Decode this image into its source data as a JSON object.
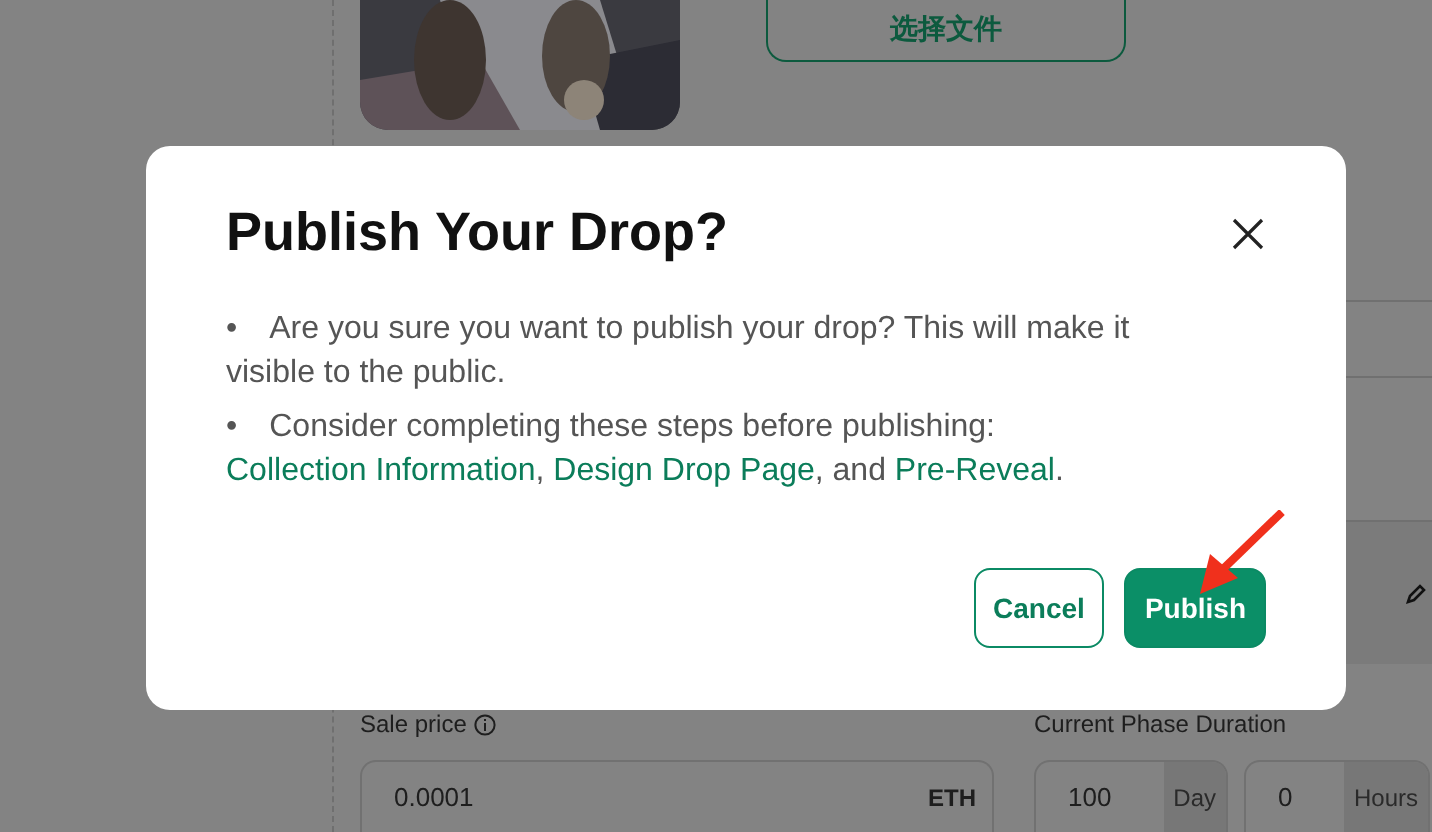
{
  "background": {
    "choose_file_button": "选择文件",
    "sale_price": {
      "label": "Sale price",
      "value": "0.0001",
      "unit": "ETH"
    },
    "duration": {
      "label": "Current Phase Duration",
      "fields": [
        {
          "value": "100",
          "unit": "Day"
        },
        {
          "value": "0",
          "unit": "Hours"
        }
      ]
    }
  },
  "dialog": {
    "title": "Publish Your Drop?",
    "marker": "•",
    "bullets": [
      [
        {
          "text": "Are you sure you want to publish your drop? This will make it visible to the public.",
          "link": false
        }
      ],
      [
        {
          "text": "Consider completing these steps before publishing: ",
          "link": false
        },
        {
          "text": "Collection Information",
          "link": true
        },
        {
          "text": ", ",
          "link": false
        },
        {
          "text": "Design Drop Page",
          "link": true
        },
        {
          "text": ", and ",
          "link": false
        },
        {
          "text": "Pre-Reveal",
          "link": true
        },
        {
          "text": ".",
          "link": false
        }
      ]
    ],
    "buttons": [
      {
        "label": "Cancel",
        "kind": "secondary"
      },
      {
        "label": "Publish",
        "kind": "primary"
      }
    ]
  }
}
